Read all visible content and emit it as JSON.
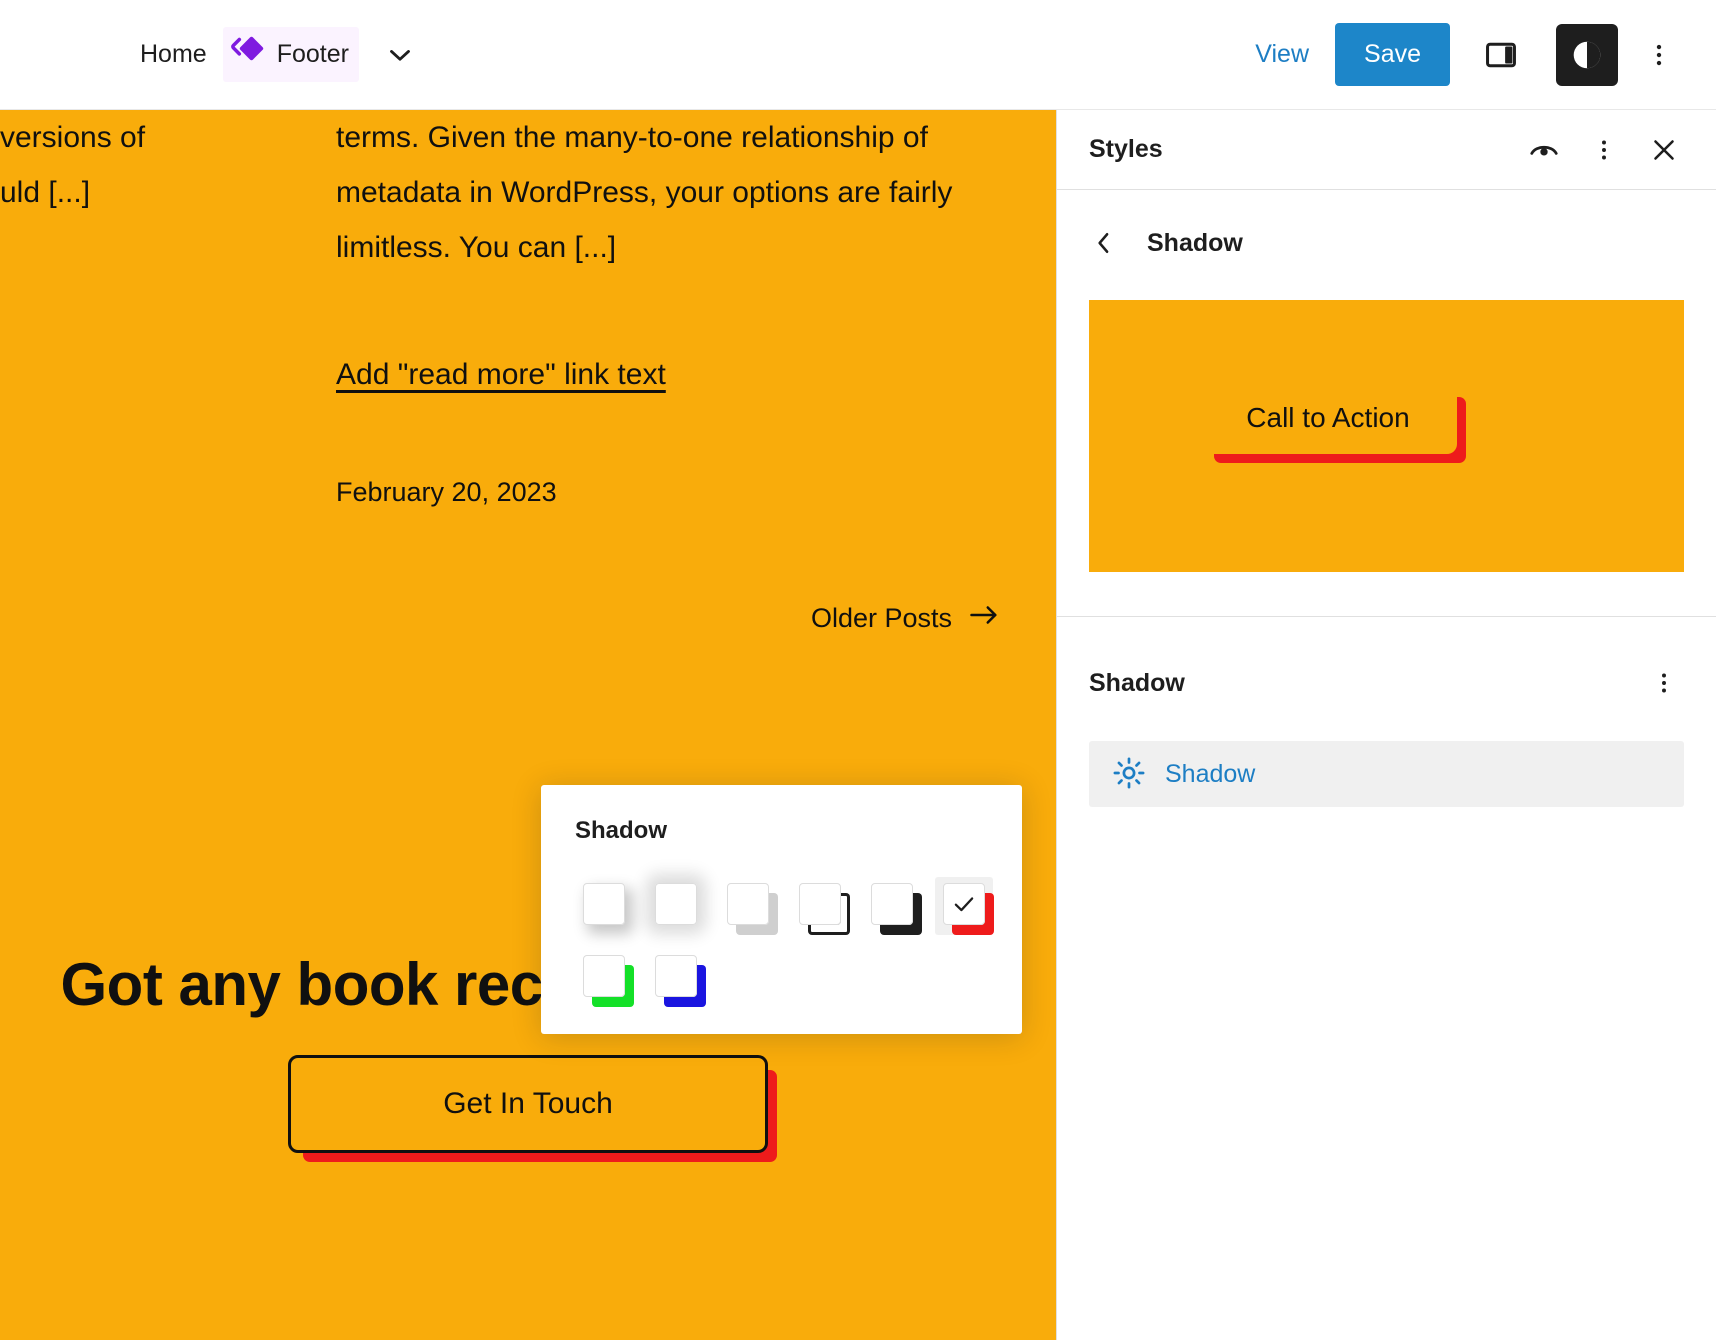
{
  "topbar": {
    "breadcrumb_home": "Home",
    "template_part_label": "Footer",
    "template_part_icon": "template-part-diamond-icon",
    "caret_icon": "chevron-down-icon",
    "view_label": "View",
    "save_label": "Save",
    "sidebar_toggle_icon": "sidebar-panel-icon",
    "styles_toggle_icon": "contrast-circle-icon",
    "more_icon": "three-dots-vertical-icon"
  },
  "canvas": {
    "background_color": "#f9ac0b",
    "left_column_excerpt": "versions of\nuld [...]",
    "right_column_excerpt": "terms. Given the many-to-one relationship of metadata in WordPress, your options are fairly limitless. You can [...]",
    "read_more_label": "Add \"read more\" link text",
    "post_date": "February 20, 2023",
    "older_posts_label": "Older Posts",
    "older_posts_icon": "arrow-right-icon",
    "cta_heading": "Got any book recommendations?",
    "cta_button_label": "Get In Touch",
    "cta_shadow_color": "#ee1b1b"
  },
  "shadow_popover": {
    "title": "Shadow",
    "swatches": [
      {
        "name": "natural-soft",
        "color": "rgba(0,0,0,0.18)",
        "style": "blur",
        "selected": false
      },
      {
        "name": "natural-deep",
        "color": "rgba(0,0,0,0.12)",
        "style": "blur-wide",
        "selected": false
      },
      {
        "name": "sharp-gray",
        "color": "#cfcfcf",
        "style": "offset",
        "selected": false
      },
      {
        "name": "outlined-black",
        "color": "#1e1e1e",
        "style": "outline",
        "selected": false
      },
      {
        "name": "crisp-black",
        "color": "#1e1e1e",
        "style": "offset",
        "selected": false
      },
      {
        "name": "crisp-red",
        "color": "#ee1b1b",
        "style": "offset",
        "selected": true
      },
      {
        "name": "crisp-green",
        "color": "#14e028",
        "style": "offset",
        "selected": false
      },
      {
        "name": "crisp-blue",
        "color": "#1a15e0",
        "style": "offset",
        "selected": false
      }
    ],
    "selected_icon": "checkmark-icon"
  },
  "sidebar": {
    "title": "Styles",
    "eye_icon": "eye-icon",
    "more_icon": "three-dots-vertical-icon",
    "close_icon": "close-x-icon",
    "back_icon": "chevron-left-icon",
    "nav_title": "Shadow",
    "preview": {
      "background_color": "#f9ac0b",
      "button_label": "Call to Action",
      "shadow_color": "#ee1b1b"
    },
    "section": {
      "title": "Shadow",
      "more_icon": "three-dots-vertical-icon",
      "row_icon": "shadow-sun-icon",
      "row_label": "Shadow"
    }
  }
}
